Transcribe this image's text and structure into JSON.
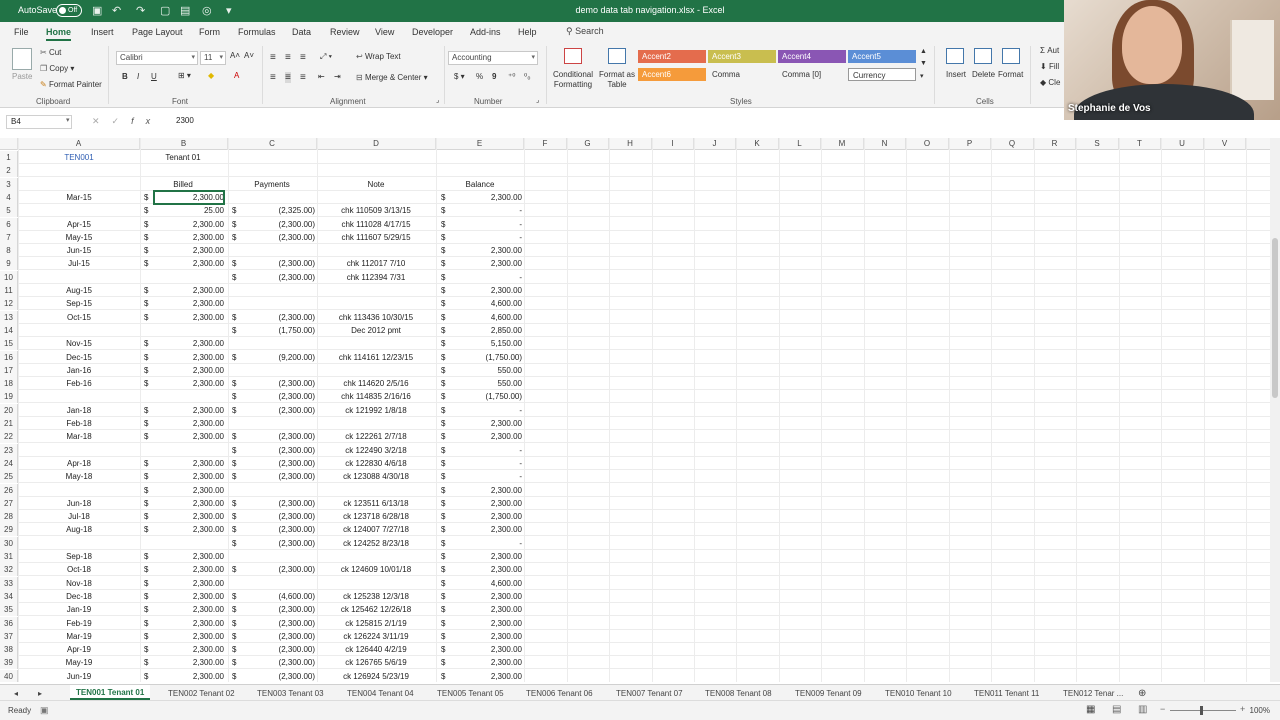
{
  "titlebar": {
    "autosave_label": "AutoSave",
    "autosave_state": "Off",
    "doc_title": "demo data tab navigation.xlsx  -  Excel"
  },
  "menu": {
    "tabs": [
      "File",
      "Home",
      "Insert",
      "Page Layout",
      "Form",
      "Formulas",
      "Data",
      "Review",
      "View",
      "Developer",
      "Add-ins",
      "Help"
    ],
    "active": "Home",
    "search": "Search"
  },
  "ribbon": {
    "clipboard": {
      "paste": "Paste",
      "cut": "Cut",
      "copy": "Copy",
      "format_painter": "Format Painter",
      "label": "Clipboard"
    },
    "font": {
      "name": "Calibri",
      "size": "11",
      "label": "Font",
      "bold": "B",
      "italic": "I",
      "underline": "U"
    },
    "alignment": {
      "wrap": "Wrap Text",
      "merge": "Merge & Center",
      "label": "Alignment"
    },
    "number": {
      "format": "Accounting",
      "label": "Number",
      "currency": "$",
      "percent": "%",
      "comma": "9"
    },
    "styles": {
      "conditional": "Conditional Formatting",
      "format_table": "Format as Table",
      "cells": [
        {
          "name": "Accent2",
          "color": "#e46c4d"
        },
        {
          "name": "Accent3",
          "color": "#c9be4f"
        },
        {
          "name": "Accent4",
          "color": "#8a56b4"
        },
        {
          "name": "Accent5",
          "color": "#5b8ed6"
        },
        {
          "name": "Accent6",
          "color": "#f59b3b"
        },
        {
          "name": "Comma",
          "color": ""
        },
        {
          "name": "Comma [0]",
          "color": ""
        },
        {
          "name": "Currency",
          "color": ""
        }
      ],
      "label": "Styles"
    },
    "cells_group": {
      "insert": "Insert",
      "delete": "Delete",
      "format": "Format",
      "label": "Cells"
    },
    "editing": {
      "auto": "Aut",
      "fill": "Fill",
      "clear": "Cle"
    }
  },
  "formulabar": {
    "namebox": "B4",
    "value": "2300"
  },
  "columns": [
    "A",
    "B",
    "C",
    "D",
    "E",
    "F",
    "G",
    "H",
    "I",
    "J",
    "K",
    "L",
    "M",
    "N",
    "O",
    "P",
    "Q",
    "R",
    "S",
    "T",
    "U",
    "V"
  ],
  "sheet": {
    "rows": [
      {
        "n": "1",
        "a": "TEN001",
        "b": "Tenant 01",
        "c": "",
        "d": "",
        "e": ""
      },
      {
        "n": "2",
        "a": "",
        "b": "",
        "c": "",
        "d": "",
        "e": ""
      },
      {
        "n": "3",
        "a": "",
        "b": "Billed",
        "c": "Payments",
        "d": "Note",
        "e": "Balance"
      },
      {
        "n": "4",
        "a": "Mar-15",
        "b": "2,300.00",
        "c": "",
        "d": "",
        "e": "2,300.00"
      },
      {
        "n": "5",
        "a": "",
        "b": "25.00",
        "c": "(2,325.00)",
        "d": "chk 110509 3/13/15",
        "e": "-"
      },
      {
        "n": "6",
        "a": "Apr-15",
        "b": "2,300.00",
        "c": "(2,300.00)",
        "d": "chk 111028 4/17/15",
        "e": "-"
      },
      {
        "n": "7",
        "a": "May-15",
        "b": "2,300.00",
        "c": "(2,300.00)",
        "d": "chk 111607 5/29/15",
        "e": "-"
      },
      {
        "n": "8",
        "a": "Jun-15",
        "b": "2,300.00",
        "c": "",
        "d": "",
        "e": "2,300.00"
      },
      {
        "n": "9",
        "a": "Jul-15",
        "b": "2,300.00",
        "c": "(2,300.00)",
        "d": "chk 112017 7/10",
        "e": "2,300.00"
      },
      {
        "n": "10",
        "a": "",
        "b": "",
        "c": "(2,300.00)",
        "d": "chk 112394 7/31",
        "e": "-"
      },
      {
        "n": "11",
        "a": "Aug-15",
        "b": "2,300.00",
        "c": "",
        "d": "",
        "e": "2,300.00"
      },
      {
        "n": "12",
        "a": "Sep-15",
        "b": "2,300.00",
        "c": "",
        "d": "",
        "e": "4,600.00"
      },
      {
        "n": "13",
        "a": "Oct-15",
        "b": "2,300.00",
        "c": "(2,300.00)",
        "d": "chk 113436 10/30/15",
        "e": "4,600.00"
      },
      {
        "n": "14",
        "a": "",
        "b": "",
        "c": "(1,750.00)",
        "d": "Dec 2012 pmt",
        "e": "2,850.00"
      },
      {
        "n": "15",
        "a": "Nov-15",
        "b": "2,300.00",
        "c": "",
        "d": "",
        "e": "5,150.00"
      },
      {
        "n": "16",
        "a": "Dec-15",
        "b": "2,300.00",
        "c": "(9,200.00)",
        "d": "chk 114161 12/23/15",
        "e": "(1,750.00)"
      },
      {
        "n": "17",
        "a": "Jan-16",
        "b": "2,300.00",
        "c": "",
        "d": "",
        "e": "550.00"
      },
      {
        "n": "18",
        "a": "Feb-16",
        "b": "2,300.00",
        "c": "(2,300.00)",
        "d": "chk 114620 2/5/16",
        "e": "550.00"
      },
      {
        "n": "19",
        "a": "",
        "b": "",
        "c": "(2,300.00)",
        "d": "chk 114835 2/16/16",
        "e": "(1,750.00)"
      },
      {
        "n": "20",
        "a": "Jan-18",
        "b": "2,300.00",
        "c": "(2,300.00)",
        "d": "ck 121992 1/8/18",
        "e": "-"
      },
      {
        "n": "21",
        "a": "Feb-18",
        "b": "2,300.00",
        "c": "",
        "d": "",
        "e": "2,300.00"
      },
      {
        "n": "22",
        "a": "Mar-18",
        "b": "2,300.00",
        "c": "(2,300.00)",
        "d": "ck 122261 2/7/18",
        "e": "2,300.00"
      },
      {
        "n": "23",
        "a": "",
        "b": "",
        "c": "(2,300.00)",
        "d": "ck 122490 3/2/18",
        "e": "-"
      },
      {
        "n": "24",
        "a": "Apr-18",
        "b": "2,300.00",
        "c": "(2,300.00)",
        "d": "ck 122830 4/6/18",
        "e": "-"
      },
      {
        "n": "25",
        "a": "May-18",
        "b": "2,300.00",
        "c": "(2,300.00)",
        "d": "ck 123088 4/30/18",
        "e": "-"
      },
      {
        "n": "26",
        "a": "",
        "b": "2,300.00",
        "c": "",
        "d": "",
        "e": "2,300.00"
      },
      {
        "n": "27",
        "a": "Jun-18",
        "b": "2,300.00",
        "c": "(2,300.00)",
        "d": "ck 123511 6/13/18",
        "e": "2,300.00"
      },
      {
        "n": "28",
        "a": "Jul-18",
        "b": "2,300.00",
        "c": "(2,300.00)",
        "d": "ck 123718 6/28/18",
        "e": "2,300.00"
      },
      {
        "n": "29",
        "a": "Aug-18",
        "b": "2,300.00",
        "c": "(2,300.00)",
        "d": "ck 124007 7/27/18",
        "e": "2,300.00"
      },
      {
        "n": "30",
        "a": "",
        "b": "",
        "c": "(2,300.00)",
        "d": "ck 124252 8/23/18",
        "e": "-"
      },
      {
        "n": "31",
        "a": "Sep-18",
        "b": "2,300.00",
        "c": "",
        "d": "",
        "e": "2,300.00"
      },
      {
        "n": "32",
        "a": "Oct-18",
        "b": "2,300.00",
        "c": "(2,300.00)",
        "d": "ck 124609 10/01/18",
        "e": "2,300.00"
      },
      {
        "n": "33",
        "a": "Nov-18",
        "b": "2,300.00",
        "c": "",
        "d": "",
        "e": "4,600.00"
      },
      {
        "n": "34",
        "a": "Dec-18",
        "b": "2,300.00",
        "c": "(4,600.00)",
        "d": "ck 125238 12/3/18",
        "e": "2,300.00"
      },
      {
        "n": "35",
        "a": "Jan-19",
        "b": "2,300.00",
        "c": "(2,300.00)",
        "d": "ck 125462 12/26/18",
        "e": "2,300.00"
      },
      {
        "n": "36",
        "a": "Feb-19",
        "b": "2,300.00",
        "c": "(2,300.00)",
        "d": "ck 125815 2/1/19",
        "e": "2,300.00"
      },
      {
        "n": "37",
        "a": "Mar-19",
        "b": "2,300.00",
        "c": "(2,300.00)",
        "d": "ck 126224 3/11/19",
        "e": "2,300.00"
      },
      {
        "n": "38",
        "a": "Apr-19",
        "b": "2,300.00",
        "c": "(2,300.00)",
        "d": "ck 126440 4/2/19",
        "e": "2,300.00"
      },
      {
        "n": "39",
        "a": "May-19",
        "b": "2,300.00",
        "c": "(2,300.00)",
        "d": "ck 126765 5/6/19",
        "e": "2,300.00"
      },
      {
        "n": "40",
        "a": "Jun-19",
        "b": "2,300.00",
        "c": "(2,300.00)",
        "d": "ck 126924 5/23/19",
        "e": "2,300.00"
      }
    ]
  },
  "sheet_tabs": [
    "TEN001 Tenant 01",
    "TEN002 Tenant 02",
    "TEN003 Tenant 03",
    "TEN004 Tenant 04",
    "TEN005 Tenant 05",
    "TEN006 Tenant 06",
    "TEN007 Tenant 07",
    "TEN008 Tenant 08",
    "TEN009 Tenant 09",
    "TEN010 Tenant 10",
    "TEN011 Tenant 11",
    "TEN012 Tenar ..."
  ],
  "status": {
    "ready": "Ready",
    "zoom": "100%"
  },
  "webcam": {
    "name": "Stephanie de Vos"
  }
}
